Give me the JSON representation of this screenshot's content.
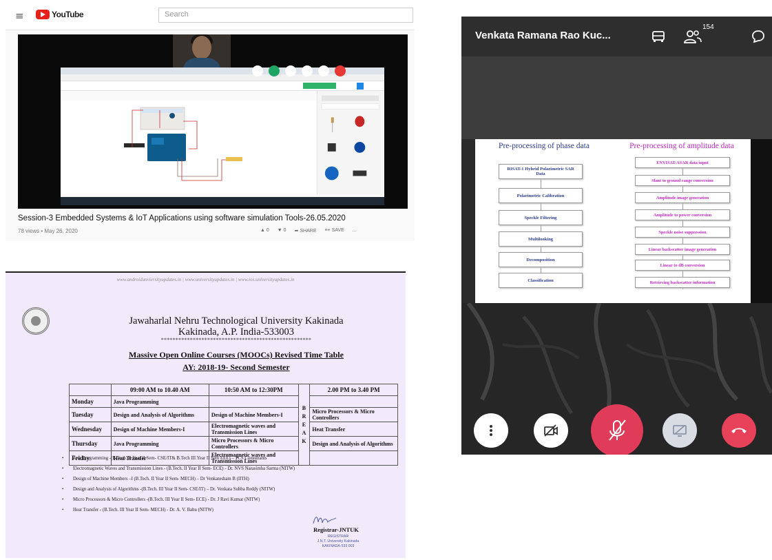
{
  "youtube": {
    "menu_glyph": "≡",
    "logo_text": "YouTube",
    "search_placeholder": "Search",
    "video_title": "Session-3 Embedded Systems & IoT Applications using software simulation Tools-26.05.2020",
    "views_date": "78 views • May 26, 2020",
    "actions": [
      {
        "icon": "thumb-up-icon",
        "label": "0"
      },
      {
        "icon": "thumb-down-icon",
        "label": "0"
      },
      {
        "icon": "share-icon",
        "label": "SHARE"
      },
      {
        "icon": "save-icon",
        "label": "SAVE"
      },
      {
        "icon": "more-icon",
        "label": "..."
      }
    ]
  },
  "timetable": {
    "websites": "www.androidunviersityupdates.in | www.universityupdates.in | www.ios.universityupdates.in",
    "university": "Jawaharlal Nehru Technological University Kakinada",
    "city": "Kakinada, A.P. India-533003",
    "stars": "****************************************************",
    "heading": "Massive Open Online Courses (MOOCs) Revised Time Table",
    "academic_year": "AY: 2018-19- Second Semester",
    "slot_headers": [
      "09:00 AM to 10.40 AM",
      "10:50 AM to 12:30PM",
      "2.00 PM to 3.40 PM"
    ],
    "break_letters": [
      "B",
      "R",
      "E",
      "A",
      "K"
    ],
    "rows": [
      {
        "day": "Monday",
        "s1": "Java Programming",
        "s2": "",
        "s3": ""
      },
      {
        "day": "Tuesday",
        "s1": "Design and Analysis of Algorithms",
        "s2": "Design of Machine Members-I",
        "s3": "Micro Processors & Micro Controllers"
      },
      {
        "day": "Wednesday",
        "s1": "Design of Machine Members-I",
        "s2": "Electromagnetic waves and Transmission Lines",
        "s3": "Heat Transfer"
      },
      {
        "day": "Thursday",
        "s1": "Java Programming",
        "s2": "Micro Processors & Micro Controllers",
        "s3": "Design and Analysis of Algorithms"
      },
      {
        "day": "Friday",
        "s1": "Heat Transfer",
        "s2": "Electromagnetic waves and Transmission Lines",
        "s3": ""
      }
    ],
    "notes": [
      "Java Programming -(B.Tech. II Year II Sem- CSE/IT& B.Tech III Year II Sem EEE) – TCS Consultants",
      "Electromagnetic Waves and Transmission Lines - (B.Tech. II Year II Sem- ECE) - Dr. NVS Narasimha Sarma (NITW)",
      "Design of Machine Members –I (B.Tech. II Year II Sem- MECH) – Dr Venkatesham B (IITH)",
      "Design and Analysis of Algorithms -(B.Tech. III Year II Sem- CSE/IT) – Dr. Venkata Subba Reddy (NITW)",
      "Micro Processors & Micro Controllers -(B.Tech. III Year II Sem- ECE) - Dr. J Ravi Kumar (NITW)",
      "Heat Transfer - (B.Tech. III Year II Sem- MECH) - Dr. A. V. Babu (NITW)"
    ],
    "registrar": "Registrar-JNTUK",
    "stamp_lines": [
      "REGISTRAR",
      "J.N.T. University Kakinada",
      "KAKINADA-533 003"
    ]
  },
  "meet": {
    "presenter_name": "Venkata Ramana Rao Kuc...",
    "participant_count": "154",
    "slide": {
      "left_title": "Pre-processing of phase data",
      "right_title": "Pre-processing of amplitude data",
      "left_steps": [
        "RISAT-1 Hybrid Polarimetric SAR Data",
        "Polarimetric Calibration",
        "Speckle Filtering",
        "Multilooking",
        "Decomposition",
        "Classification"
      ],
      "right_steps": [
        "ENVISAT-ASAR data input",
        "Slant to ground range conversion",
        "Amplitude image generation",
        "Amplitude to power conversion",
        "Speckle noise suppression",
        "Linear backscatter image generation",
        "Linear to dB conversion",
        "Retrieving backscatter information"
      ]
    },
    "colors": {
      "end_call": "#e8415a",
      "mic_off": "#e13b5a",
      "left_text": "#2a3a8a",
      "right_text": "#c02ac0"
    }
  }
}
